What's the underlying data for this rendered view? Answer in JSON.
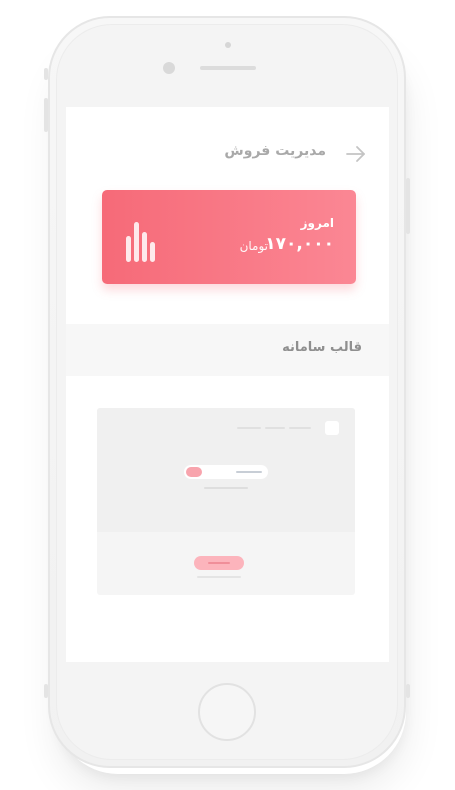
{
  "header": {
    "title": "مدیریت فروش",
    "back_icon": "arrow-right-icon"
  },
  "sales_card": {
    "label": "امروز",
    "amount": "۱۷۰,۰۰۰",
    "currency": "تومان",
    "icon": "bar-chart-icon",
    "accent_color": "#f66a78"
  },
  "section": {
    "title": "قالب سامانه"
  },
  "colors": {
    "screen_bg": "#ffffff",
    "section_bg": "#f7f7f7",
    "muted_text": "#a9a9a9",
    "preview_accent": "#f8a4ad"
  }
}
